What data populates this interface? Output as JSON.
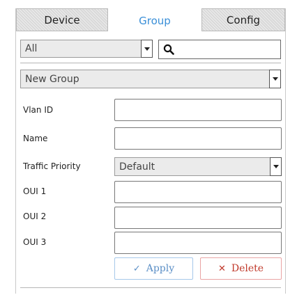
{
  "tabs": [
    {
      "label": "Device"
    },
    {
      "label": "Group"
    },
    {
      "label": "Config"
    }
  ],
  "active_tab": "Group",
  "filter": {
    "selected": "All"
  },
  "search": {
    "value": ""
  },
  "group_select": {
    "selected": "New Group"
  },
  "form": {
    "vlan_id": {
      "label": "Vlan ID",
      "value": ""
    },
    "name": {
      "label": "Name",
      "value": ""
    },
    "traffic_priority": {
      "label": "Traffic Priority",
      "selected": "Default"
    },
    "oui1": {
      "label": "OUI 1",
      "value": ""
    },
    "oui2": {
      "label": "OUI 2",
      "value": ""
    },
    "oui3": {
      "label": "OUI 3",
      "value": ""
    }
  },
  "buttons": {
    "apply": {
      "label": "Apply",
      "icon": "check-icon"
    },
    "delete": {
      "label": "Delete",
      "icon": "x-icon"
    }
  },
  "colors": {
    "active_tab_text": "#3a8fd8",
    "apply": "#5b8fc6",
    "delete": "#c0392b"
  }
}
